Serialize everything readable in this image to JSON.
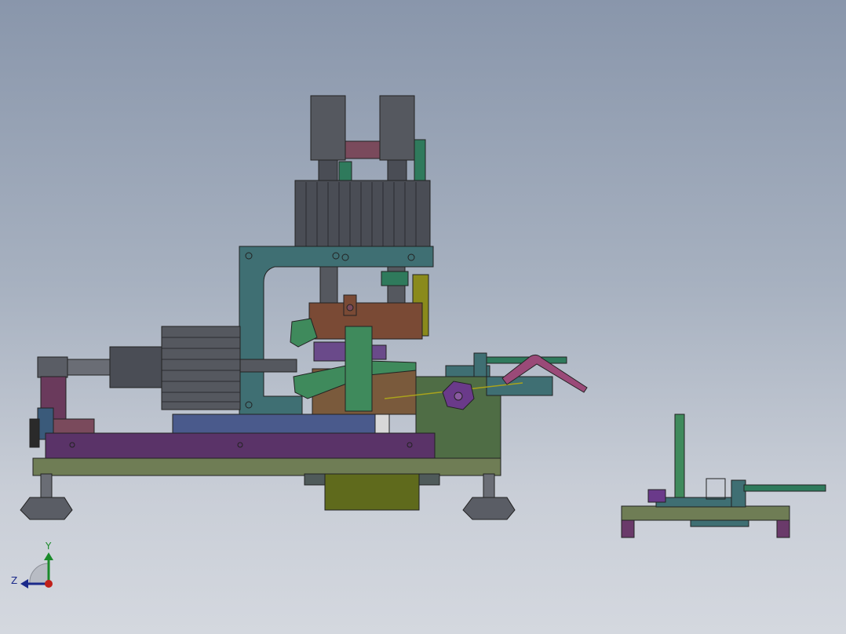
{
  "viewport": {
    "background_top": "#8996ab",
    "background_bottom": "#d4d8df"
  },
  "triad": {
    "y_label": "Y",
    "z_label": "Z",
    "y_color": "#1a8a2a",
    "z_color": "#1b2a8a",
    "origin_color": "#c0201a"
  },
  "colors": {
    "cylinder_gray": "#55585f",
    "frame_teal": "#3f6f73",
    "block_brown": "#7a4a35",
    "plate_purple": "#5a3368",
    "base_olive": "#6f7d55",
    "bar_blue": "#4a5a8c",
    "tray_olive": "#5f6a1c",
    "rod_green": "#2f7a5c",
    "tube_magenta": "#9a4a78",
    "accent_yellow": "#8a8a1c"
  }
}
